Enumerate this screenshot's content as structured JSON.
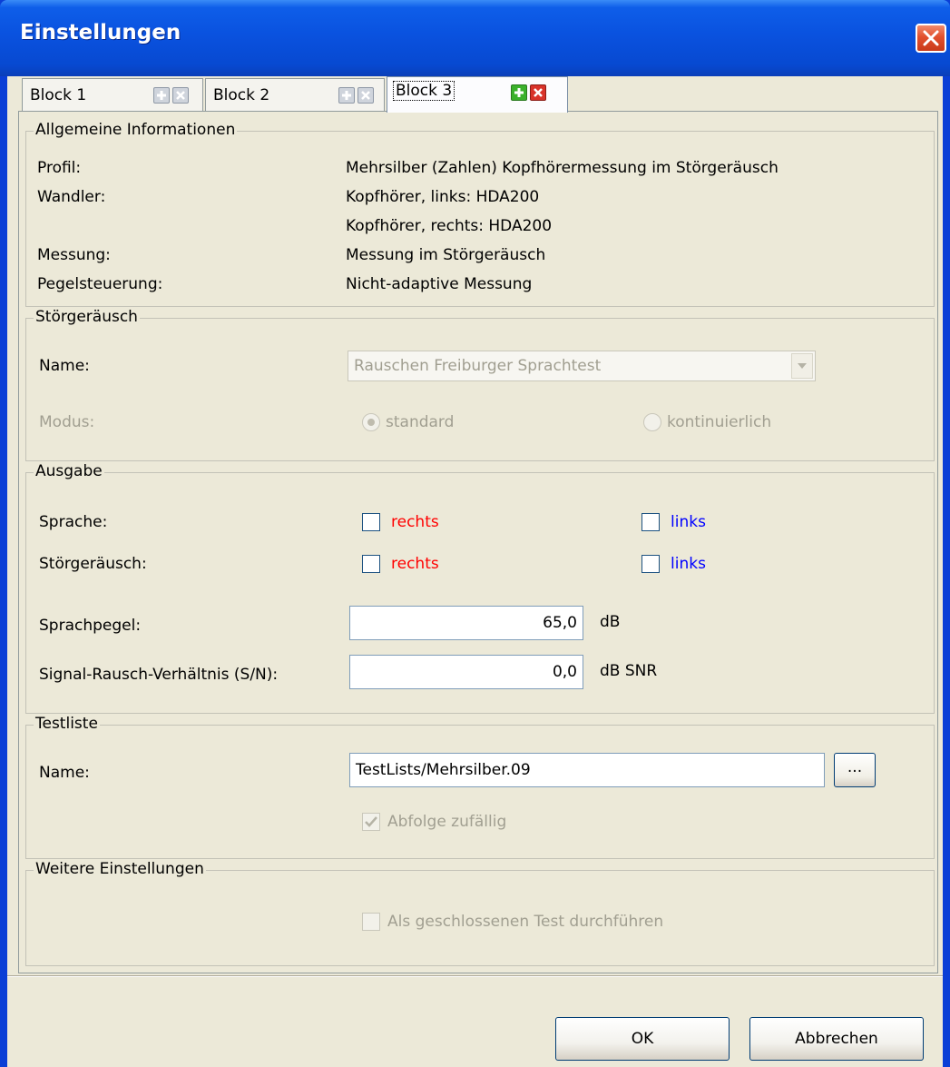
{
  "window": {
    "title": "Einstellungen"
  },
  "tabs": [
    {
      "label": "Block 1",
      "active": false
    },
    {
      "label": "Block 2",
      "active": false
    },
    {
      "label": "Block 3",
      "active": true
    }
  ],
  "general": {
    "title": "Allgemeine Informationen",
    "rows": [
      {
        "label": "Profil:",
        "value": "Mehrsilber (Zahlen) Kopfhörermessung im Störgeräusch"
      },
      {
        "label": "Wandler:",
        "value": "Kopfhörer, links: HDA200"
      },
      {
        "label": "",
        "value": "Kopfhörer, rechts: HDA200"
      },
      {
        "label": "Messung:",
        "value": "Messung im Störgeräusch"
      },
      {
        "label": "Pegelsteuerung:",
        "value": "Nicht-adaptive Messung"
      }
    ]
  },
  "noise": {
    "title": "Störgeräusch",
    "name_label": "Name:",
    "name_value": "Rauschen Freiburger Sprachtest",
    "mode_label": "Modus:",
    "mode_standard": "standard",
    "mode_continuous": "kontinuierlich",
    "selected_mode": "standard"
  },
  "output": {
    "title": "Ausgabe",
    "speech_label": "Sprache:",
    "noise_label": "Störgeräusch:",
    "right_label": "rechts",
    "left_label": "links",
    "right_color": "#ff0000",
    "left_color": "#0000ff",
    "speech_right_checked": false,
    "speech_left_checked": false,
    "noise_right_checked": false,
    "noise_left_checked": false,
    "level_label": "Sprachpegel:",
    "level_value": "65,0",
    "level_unit": "dB",
    "snr_label": "Signal-Rausch-Verhältnis (S/N):",
    "snr_value": "0,0",
    "snr_unit": "dB SNR"
  },
  "testlist": {
    "title": "Testliste",
    "name_label": "Name:",
    "name_value": "TestLists/Mehrsilber.09",
    "browse_label": "...",
    "random_label": "Abfolge zufällig",
    "random_checked": true
  },
  "more": {
    "title": "Weitere Einstellungen",
    "closed_label": "Als geschlossenen Test durchführen",
    "closed_checked": false
  },
  "buttons": {
    "ok": "OK",
    "cancel": "Abbrechen"
  }
}
